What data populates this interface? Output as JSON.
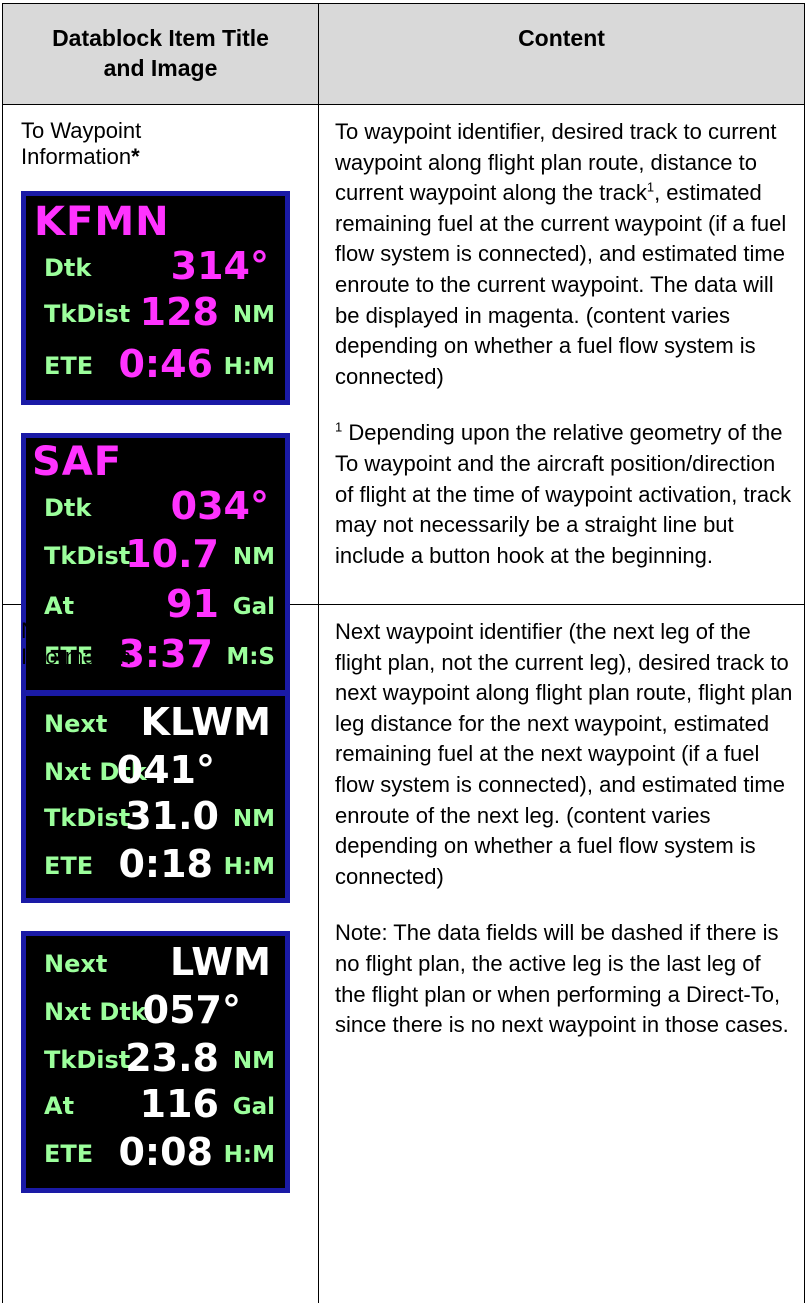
{
  "header": {
    "col1_line1": "Datablock Item Title",
    "col1_line2": "and Image",
    "col2": "Content"
  },
  "row1": {
    "title_line1": "To Waypoint",
    "title_line2": "Information",
    "title_asterisk": "*",
    "panel1": {
      "ident": "KFMN",
      "dtk_label": "Dtk",
      "dtk_value": "314°",
      "dist_label": "TkDist",
      "dist_value": "128",
      "dist_unit": "NM",
      "ete_label": "ETE",
      "ete_value": "0:46",
      "ete_unit": "H:M"
    },
    "panel2": {
      "ident": "SAF",
      "dtk_label": "Dtk",
      "dtk_value": "034°",
      "dist_label": "TkDist",
      "dist_value": "10.7",
      "dist_unit": "NM",
      "at_label": "At",
      "at_value": "91",
      "at_unit": "Gal",
      "ete_label": "ETE",
      "ete_value": "3:37",
      "ete_unit": "M:S"
    },
    "content_pre": "To waypoint identifier, desired track to current waypoint along flight plan route, distance to current waypoint along the track",
    "content_sup": "1",
    "content_post": ", estimated remaining fuel at the current waypoint (if a fuel flow system is connected), and estimated time enroute to the current waypoint. The data will be displayed in magenta. (content varies depending on whether a fuel flow system is connected)",
    "footnote_mark": "1",
    "footnote_text": " Depending upon the relative geometry of the To waypoint and the aircraft position/direction of flight at the time of waypoint activation, track may not necessarily be a straight line but include a button hook at the beginning."
  },
  "row2": {
    "title_line1": "Next Waypoint",
    "title_line2": "Information",
    "panel1": {
      "next_label": "Next",
      "ident": "KLWM",
      "dtk_label": "Nxt Dtk",
      "dtk_value": "041°",
      "dist_label": "TkDist",
      "dist_value": "31.0",
      "dist_unit": "NM",
      "ete_label": "ETE",
      "ete_value": "0:18",
      "ete_unit": "H:M"
    },
    "panel2": {
      "next_label": "Next",
      "ident": "LWM",
      "dtk_label": "Nxt Dtk",
      "dtk_value": "057°",
      "dist_label": "TkDist",
      "dist_value": "23.8",
      "dist_unit": "NM",
      "at_label": "At",
      "at_value": "116",
      "at_unit": "Gal",
      "ete_label": "ETE",
      "ete_value": "0:08",
      "ete_unit": "H:M"
    },
    "content": "Next waypoint identifier (the next leg of the flight plan, not the current leg), desired track to next waypoint along flight plan route, flight plan leg distance for the next waypoint, estimated remaining fuel at the next waypoint (if a fuel flow system is connected), and estimated time enroute of the next leg. (content varies depending on whether a fuel flow system is connected)",
    "note": "Note:  The data fields will be dashed if there is no flight plan, the active leg is the last leg of the flight plan or when performing a Direct-To, since there is no next waypoint in those cases."
  },
  "colors": {
    "magenta": "#ff33ff",
    "label_green": "#9cff9c",
    "panel_border": "#1a1aa6",
    "header_gray": "#d9d9d9"
  }
}
